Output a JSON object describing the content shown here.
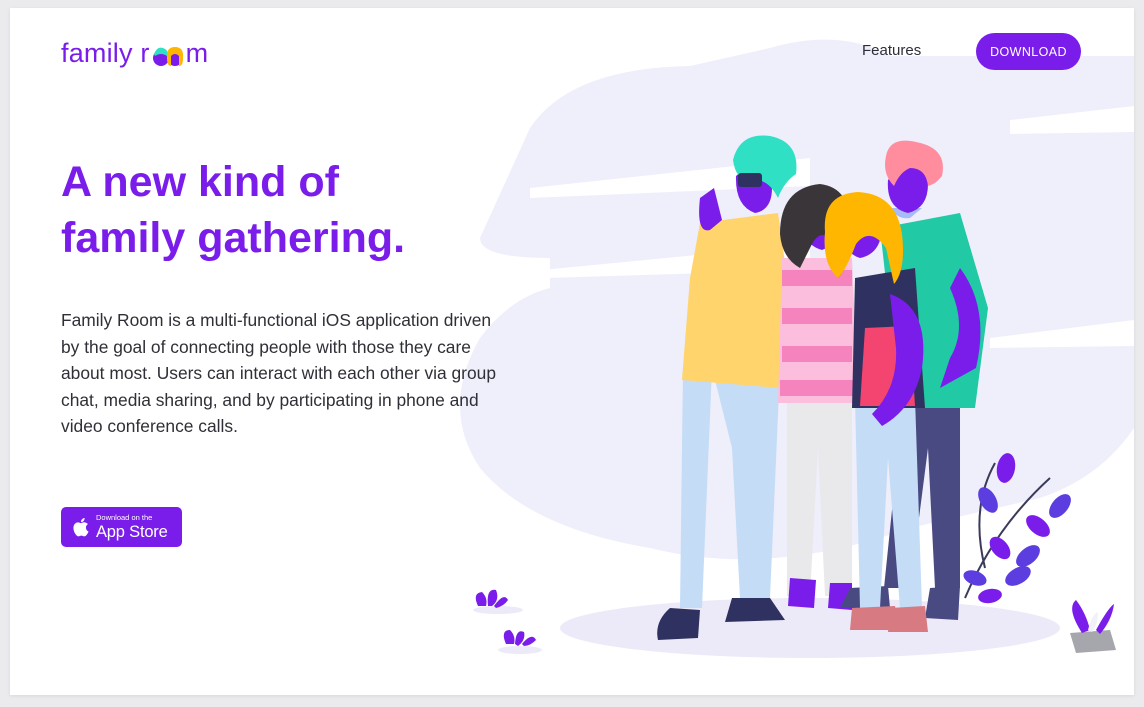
{
  "brand": {
    "logo_prefix": "family r",
    "logo_suffix": "m",
    "logo_icon": "two-faces-logo-icon",
    "accent_color": "#7a1dea"
  },
  "nav": {
    "features_label": "Features",
    "download_label": "DOWNLOAD"
  },
  "hero": {
    "headline_line1": "A new kind of",
    "headline_line2": "family gathering.",
    "description": "Family Room is a multi-functional iOS application driven by the goal of connecting people with those they care about most. Users can interact with each other via group chat, media sharing, and by participating in phone and video conference calls."
  },
  "appstore_badge": {
    "small_text": "Download on the",
    "big_text": "App Store",
    "icon": "apple-icon"
  },
  "illustration": {
    "subject": "group-selfie-illustration",
    "icon": "people-selfie-icon"
  }
}
